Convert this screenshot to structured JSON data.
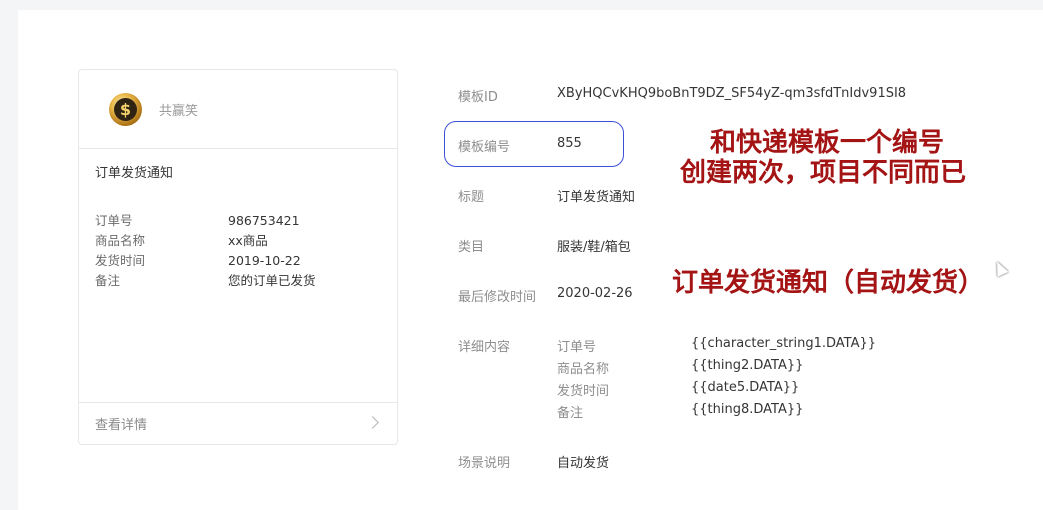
{
  "preview": {
    "app_name": "共赢笑",
    "coin_symbol": "$",
    "title": "订单发货通知",
    "fields": [
      {
        "key": "订单号",
        "value": "986753421"
      },
      {
        "key": "商品名称",
        "value": "xx商品"
      },
      {
        "key": "发货时间",
        "value": "2019-10-22"
      },
      {
        "key": "备注",
        "value": "您的订单已发货"
      }
    ],
    "footer_link": "查看详情"
  },
  "details": {
    "template_id_label": "模板ID",
    "template_id": "XByHQCvKHQ9boBnT9DZ_SF54yZ-qm3sfdTnIdv91SI8",
    "template_no_label": "模板编号",
    "template_no": "855",
    "title_label": "标题",
    "title": "订单发货通知",
    "category_label": "类目",
    "category": "服装/鞋/箱包",
    "modified_label": "最后修改时间",
    "modified": "2020-02-26",
    "content_label": "详细内容",
    "content": [
      {
        "key": "订单号",
        "value": "{{character_string1.DATA}}"
      },
      {
        "key": "商品名称",
        "value": "{{thing2.DATA}}"
      },
      {
        "key": "发货时间",
        "value": "{{date5.DATA}}"
      },
      {
        "key": "备注",
        "value": "{{thing8.DATA}}"
      }
    ],
    "scene_label": "场景说明",
    "scene": "自动发货"
  },
  "annotations": {
    "line1": "和快递模板一个编号",
    "line2": "创建两次，项目不同而已",
    "line3": "订单发货通知（自动发货）",
    "color": "#a41414",
    "highlight_color": "#3b4fd8"
  }
}
